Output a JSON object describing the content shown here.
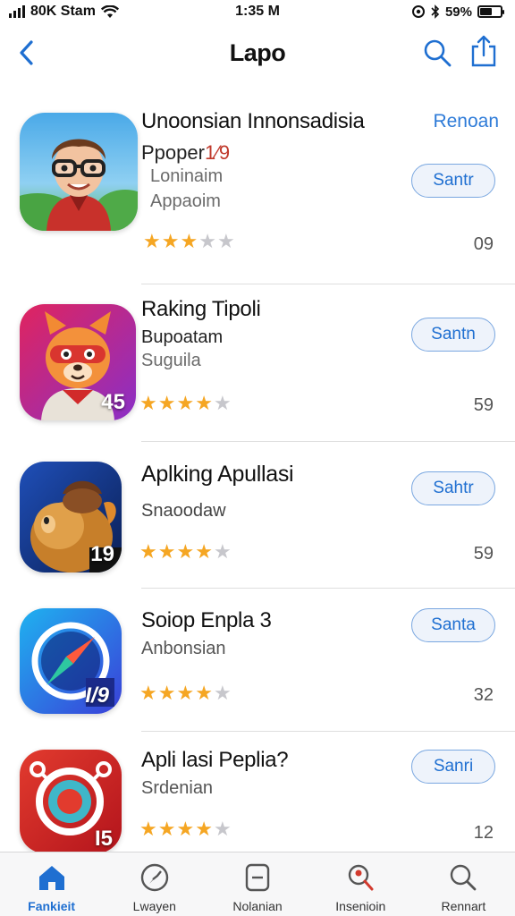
{
  "status_bar": {
    "carrier": "80K Stam",
    "time": "1:35 M",
    "battery": "59%",
    "battery_level": 0.59
  },
  "nav": {
    "title": "Lapo"
  },
  "apps": [
    {
      "title": "Unoonsian Innonsadisia",
      "subtitle": "Ppoper",
      "subtitle_mark": "1⁄9",
      "line3": "Loninaim",
      "line4": "Appaoim",
      "link": "Renoan",
      "button": "Santr",
      "count": "09",
      "rating": 3.5
    },
    {
      "title": "Raking Tipoli",
      "subtitle": "Bupoatam",
      "line3": "Suguila",
      "badge": "45",
      "button": "Santn",
      "count": "59",
      "rating": 4
    },
    {
      "title": "Aplking Apullasi",
      "line3": "Snaoodaw",
      "badge": "19",
      "button": "Sahtr",
      "count": "59",
      "rating": 4
    },
    {
      "title": "Soiop Enpla 3",
      "line3": "Anbonsian",
      "badge": "I/9",
      "button": "Santa",
      "count": "32",
      "rating": 4
    },
    {
      "title": "Apli lasi Peplia?",
      "line3": "Srdenian",
      "badge": "I5",
      "button": "Sanri",
      "count": "12",
      "rating": 4
    }
  ],
  "tabs": [
    {
      "label": "Fankieit",
      "icon": "home-icon"
    },
    {
      "label": "Lwayen",
      "icon": "compass-icon"
    },
    {
      "label": "Nolanian",
      "icon": "card-icon"
    },
    {
      "label": "Insenioin",
      "icon": "search-person-icon"
    },
    {
      "label": "Rennart",
      "icon": "search-icon"
    }
  ],
  "colors": {
    "accent": "#1f6fd1",
    "star": "#f5a623",
    "separator": "#dedede"
  }
}
